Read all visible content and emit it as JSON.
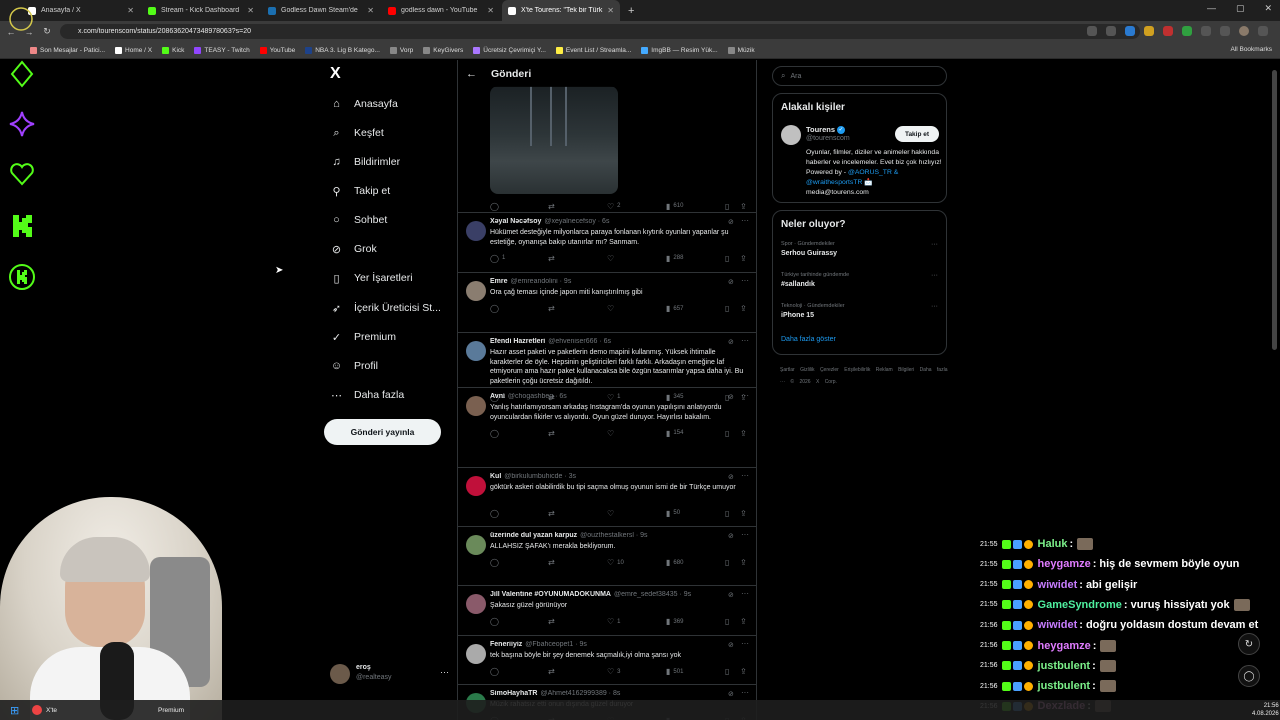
{
  "browser": {
    "tabs": [
      {
        "title": "Anasayfa / X",
        "color": "#ffffff"
      },
      {
        "title": "Stream - Kick Dashboard",
        "color": "#53fc18"
      },
      {
        "title": "Godless Dawn Steam'de",
        "color": "#1b6fb0"
      },
      {
        "title": "godless dawn - YouTube",
        "color": "#ff0000"
      },
      {
        "title": "X'te Tourens: \"Tek bir Türk geliş",
        "color": "#ffffff"
      }
    ],
    "url": "x.com/tourenscom/status/2086362047348978063?s=20",
    "bookmarks": [
      {
        "label": "Son Mesajlar - Patici...",
        "color": "#e88"
      },
      {
        "label": "Home / X",
        "color": "#fff"
      },
      {
        "label": "Kick",
        "color": "#53fc18"
      },
      {
        "label": "TEASY - Twitch",
        "color": "#9146ff"
      },
      {
        "label": "YouTube",
        "color": "#ff0000"
      },
      {
        "label": "NBA 3. Lig B Katego...",
        "color": "#1d428a"
      },
      {
        "label": "Vorp",
        "color": "#888"
      },
      {
        "label": "KeyGivers",
        "color": "#888"
      },
      {
        "label": "Ücretsiz Çevrimiçi Y...",
        "color": "#a7f"
      },
      {
        "label": "Event List / Streamla...",
        "color": "#fe4"
      },
      {
        "label": "ImgBB — Resim Yük...",
        "color": "#4af"
      },
      {
        "label": "Müzik",
        "color": "#888"
      }
    ],
    "all_bookmarks": "All Bookmarks"
  },
  "xnav": {
    "logo": "X",
    "items": [
      {
        "label": "Anasayfa",
        "icon": "home-icon",
        "glyph": "⌂"
      },
      {
        "label": "Keşfet",
        "icon": "search-icon",
        "glyph": "⌕"
      },
      {
        "label": "Bildirimler",
        "icon": "bell-icon",
        "glyph": "🔔︎"
      },
      {
        "label": "Takip et",
        "icon": "follow-icon",
        "glyph": "👤︎"
      },
      {
        "label": "Sohbet",
        "icon": "chat-icon",
        "glyph": "◯"
      },
      {
        "label": "Grok",
        "icon": "grok-icon",
        "glyph": "⊘"
      },
      {
        "label": "Yer İşaretleri",
        "icon": "bookmark-icon",
        "glyph": "⎕"
      },
      {
        "label": "İçerik Üreticisi St...",
        "icon": "creator-icon",
        "glyph": "➶"
      },
      {
        "label": "Premium",
        "icon": "premium-icon",
        "glyph": "✓"
      },
      {
        "label": "Profil",
        "icon": "profile-icon",
        "glyph": "👤︎"
      },
      {
        "label": "Daha fazla",
        "icon": "more-icon",
        "glyph": "⋯"
      }
    ],
    "post_button": "Gönderi yayınla",
    "profile": {
      "name": "eroş",
      "handle": "@realteasy"
    }
  },
  "main": {
    "title": "Gönderi",
    "top_actions": {
      "retweets": "2",
      "views": "610"
    },
    "replies": [
      {
        "name": "Xəyal Nəcəfsoy",
        "handle": "@xeyalnecefsoy · 6s",
        "text": "Hükümet desteğiyle milyonlarca paraya fonlanan kıytırık oyunları yapanlar şu estetiğe, oynanışa bakıp utanırlar mı? Sanmam.",
        "replies": "1",
        "likes": "",
        "views": "288",
        "avatar": "#3a3f66"
      },
      {
        "name": "Emre",
        "handle": "@emreandolini · 9s",
        "text": "Ora çağ teması içinde japon miti kanıştırılmış gibi",
        "replies": "",
        "likes": "",
        "views": "657",
        "avatar": "#8a7d70"
      },
      {
        "name": "Efendi Hazretleri",
        "handle": "@ehveniser666 · 6s",
        "text": "Hazır asset paketi ve paketlerin demo mapini kullanmış. Yüksek ihtimalle karakterler de öyle. Hepsinin geliştiricileri farklı farklı. Arkadaşın emeğine laf etmiyorum ama hazır paket kullanacaksa bile özgün tasarımlar yapsa daha iyi. Bu paketlerin çoğu ücretsiz dağıtıldı.",
        "replies": "1",
        "likes": "1",
        "views": "345",
        "avatar": "#5a7a9a"
      },
      {
        "name": "Avni",
        "handle": "@chogashbeg · 6s",
        "text": "Yanlış hatırlamıyorsam arkadaş Instagram'da oyunun yapılışını anlatıyordu oyunculardan fikirler vs alıyordu. Oyun güzel duruyor. Hayırlısı bakalım.",
        "replies": "",
        "likes": "",
        "views": "154",
        "avatar": "#7a6050"
      },
      {
        "name": "Kul",
        "handle": "@birkulumbuhicde · 3s",
        "text": "göktürk askeri olabilirdik bu tipi saçma olmuş oyunun ismi de bir Türkçe umuyor",
        "replies": "",
        "likes": "",
        "views": "50",
        "avatar": "#c0103a"
      },
      {
        "name": "üzerinde dul yazan karpuz",
        "handle": "@ouzthestalkersl · 9s",
        "text": "ALLAHSIZ ŞAFAK'ı merakla bekliyorum.",
        "replies": "",
        "likes": "10",
        "views": "680",
        "avatar": "#6a8a5a"
      },
      {
        "name": "Jill Valentine #OYUNUMADOKUNMA",
        "handle": "@emre_sedef38435 · 9s",
        "text": "Şakasız güzel görünüyor",
        "replies": "",
        "likes": "1",
        "views": "369",
        "avatar": "#8a5a6a"
      },
      {
        "name": "Feneriiyiz",
        "handle": "@Fbahceopet1 · 9s",
        "text": "tek başına böyle bir şey denemek saçmalık,iyi olma şansı yok",
        "replies": "",
        "likes": "3",
        "views": "501",
        "avatar": "#aaa"
      },
      {
        "name": "SimoHayhaTR",
        "handle": "@Ahmet4162999389 · 8s",
        "text": "Müzik rahatsız etti onun dışında güzel duruyor",
        "replies": "",
        "likes": "",
        "views": "",
        "avatar": "#2a7a4a"
      }
    ]
  },
  "sidebar": {
    "search_placeholder": "Ara",
    "related_title": "Alakalı kişiler",
    "related": {
      "name": "Tourens",
      "handle": "@tourenscom",
      "follow": "Takip et",
      "bio": "Oyunlar, filmler, diziler ve animeler hakkında haberler ve incelemeler. Evet biz çok hızlıyız! Powered by -",
      "bio_links": "@AORUS_TR & @wraithesportsTR 📩",
      "bio_email": "media@tourens.com"
    },
    "trends_title": "Neler oluyor?",
    "trends": [
      {
        "category": "Spor · Gündemdekiler",
        "topic": "Serhou Guirassy"
      },
      {
        "category": "Türkiye tarihinde gündemde",
        "topic": "#sallandık"
      },
      {
        "category": "Teknoloji · Gündemdekiler",
        "topic": "iPhone 15"
      }
    ],
    "show_more": "Daha fazla göster",
    "footer": "Şartlar   Gizlilik   Çerezler   Erişilebilirlik   Reklam Bilgileri   Daha fazla ···   © 2026 X Corp."
  },
  "chat": {
    "messages": [
      {
        "time": "21:55",
        "user": "Haluk",
        "color": "#7cf08a",
        "text": ""
      },
      {
        "time": "21:55",
        "user": "heygamze",
        "color": "#e07cff",
        "text": "hiş de sevmem böyle oyun"
      },
      {
        "time": "21:55",
        "user": "wiwidet",
        "color": "#c77dff",
        "text": "abi gelişir"
      },
      {
        "time": "21:55",
        "user": "GameSyndrome",
        "color": "#4ff0a0",
        "text": "vuruş hissiyatı yok"
      },
      {
        "time": "21:56",
        "user": "wiwidet",
        "color": "#c77dff",
        "text": "doğru yoldasın dostum devam et"
      },
      {
        "time": "21:56",
        "user": "heygamze",
        "color": "#e07cff",
        "text": ""
      },
      {
        "time": "21:56",
        "user": "justbulent",
        "color": "#7cf08a",
        "text": ""
      },
      {
        "time": "21:56",
        "user": "justbulent",
        "color": "#7cf08a",
        "text": ""
      },
      {
        "time": "21:56",
        "user": "Dexzlade",
        "color": "#ff9ee8",
        "text": ""
      }
    ]
  },
  "taskbar": {
    "item": "X'te",
    "item2": "Premium",
    "time": "21:56",
    "date": "4.08.2026"
  },
  "colors": {
    "accent": "#1d9bf0",
    "kick": "#53fc18"
  }
}
